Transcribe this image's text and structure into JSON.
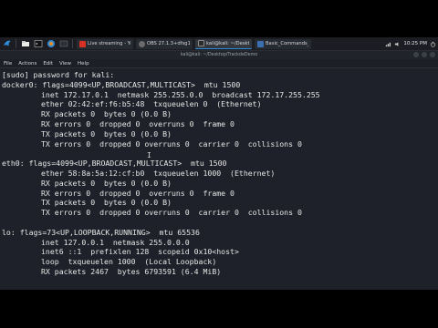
{
  "taskbar": {
    "launchers": [
      {
        "icon": "kali-dragon-icon",
        "label": ""
      },
      {
        "icon": "file-manager-icon",
        "label": ""
      },
      {
        "icon": "terminal-icon",
        "label": ""
      },
      {
        "icon": "browser-icon",
        "label": ""
      },
      {
        "icon": "workspace-icon",
        "label": ""
      }
    ],
    "tasks": [
      {
        "label": "Live streaming - You...",
        "color": "#d93025",
        "active": false
      },
      {
        "label": "OBS 27.1.3+dfsg1-1 (...",
        "color": "#6b6b6b",
        "active": false
      },
      {
        "label": "kali@kali: ~/Desktop...",
        "color": "#2b2b2b",
        "active": true
      },
      {
        "label": "Basic_Commands_5...",
        "color": "#3c6fb0",
        "active": false
      }
    ],
    "clock": "10:25 PM"
  },
  "window": {
    "title": "kali@kali: ~/Desktop/TrackdeDemo"
  },
  "menu": [
    "File",
    "Actions",
    "Edit",
    "View",
    "Help"
  ],
  "terminal": {
    "lines": [
      {
        "text": "[sudo] password for kali:",
        "indent": false
      },
      {
        "text": "docker0: flags=4099<UP,BROADCAST,MULTICAST>  mtu 1500",
        "indent": false
      },
      {
        "text": "inet 172.17.0.1  netmask 255.255.0.0  broadcast 172.17.255.255",
        "indent": true
      },
      {
        "text": "ether 02:42:ef:f6:b5:48  txqueuelen 0  (Ethernet)",
        "indent": true
      },
      {
        "text": "RX packets 0  bytes 0 (0.0 B)",
        "indent": true
      },
      {
        "text": "RX errors 0  dropped 0  overruns 0  frame 0",
        "indent": true
      },
      {
        "text": "TX packets 0  bytes 0 (0.0 B)",
        "indent": true
      },
      {
        "text": "TX errors 0  dropped 0 overruns 0  carrier 0  collisions 0",
        "indent": true
      },
      {
        "text": "",
        "indent": false
      },
      {
        "text": "eth0: flags=4099<UP,BROADCAST,MULTICAST>  mtu 1500",
        "indent": false
      },
      {
        "text": "ether 58:8a:5a:12:cf:b0  txqueuelen 1000  (Ethernet)",
        "indent": true
      },
      {
        "text": "RX packets 0  bytes 0 (0.0 B)",
        "indent": true
      },
      {
        "text": "RX errors 0  dropped 0  overruns 0  frame 0",
        "indent": true
      },
      {
        "text": "TX packets 0  bytes 0 (0.0 B)",
        "indent": true
      },
      {
        "text": "TX errors 0  dropped 0 overruns 0  carrier 0  collisions 0",
        "indent": true
      },
      {
        "text": "",
        "indent": false
      },
      {
        "text": "lo: flags=73<UP,LOOPBACK,RUNNING>  mtu 65536",
        "indent": false
      },
      {
        "text": "inet 127.0.0.1  netmask 255.0.0.0",
        "indent": true
      },
      {
        "text": "inet6 ::1  prefixlen 128  scopeid 0x10<host>",
        "indent": true
      },
      {
        "text": "loop  txqueuelen 1000  (Local Loopback)",
        "indent": true
      },
      {
        "text": "RX packets 2467  bytes 6793591 (6.4 MiB)",
        "indent": true
      }
    ],
    "cursor_glyph": "I"
  }
}
